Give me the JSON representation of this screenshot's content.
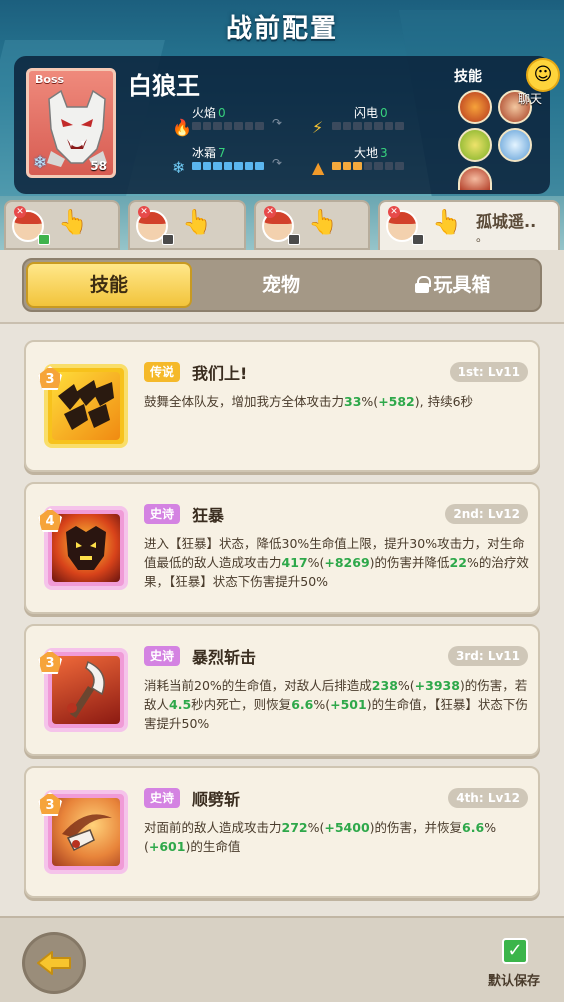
{
  "header": {
    "title": "战前配置"
  },
  "boss": {
    "badge": "Boss",
    "name": "白狼王",
    "level": "58",
    "element_icon": "snowflake-icon",
    "stats": [
      {
        "name": "火焰",
        "value": "0",
        "icon": "fire-icon",
        "filled": 0,
        "total": 7
      },
      {
        "name": "闪电",
        "value": "0",
        "icon": "lightning-icon",
        "filled": 0,
        "total": 7
      },
      {
        "name": "冰霜",
        "value": "7",
        "icon": "snowflake-icon",
        "filled": 7,
        "total": 7
      },
      {
        "name": "大地",
        "value": "3",
        "icon": "earth-icon",
        "filled": 3,
        "total": 7
      }
    ],
    "skills_label": "技能",
    "skill_icons": [
      "wolf-howl-icon",
      "slash-icon",
      "shield-icon",
      "crystal-icon",
      "claw-icon"
    ]
  },
  "chat": {
    "label": "聊天"
  },
  "heroes": [
    {
      "name": "",
      "badge": "green"
    },
    {
      "name": "",
      "badge": "gray"
    },
    {
      "name": "",
      "badge": "gray"
    },
    {
      "name": "孤城遥..",
      "name2": "。",
      "badge": "gray",
      "active": true
    }
  ],
  "tabs": {
    "skills": "技能",
    "pets": "宠物",
    "toybox": "玩具箱"
  },
  "skills": [
    {
      "stars": "3",
      "rarity": "传说",
      "rarity_class": "legend",
      "name": "我们上!",
      "level": "1st: Lv11",
      "desc": [
        [
          "t",
          "鼓舞全体队友，增加我方全体攻击力"
        ],
        [
          "g",
          "33"
        ],
        [
          "t",
          "%("
        ],
        [
          "g",
          "+582"
        ],
        [
          "t",
          "), 持续6秒"
        ]
      ]
    },
    {
      "stars": "4",
      "rarity": "史诗",
      "rarity_class": "epic",
      "name": "狂暴",
      "level": "2nd: Lv12",
      "desc": [
        [
          "t",
          "进入【狂暴】状态，降低30%生命值上限，提升30%攻击力，对生命值最低的敌人造成攻击力"
        ],
        [
          "g",
          "417"
        ],
        [
          "t",
          "%("
        ],
        [
          "g",
          "+8269"
        ],
        [
          "t",
          ")的伤害并降低"
        ],
        [
          "g",
          "22"
        ],
        [
          "t",
          "%的治疗效果，【狂暴】状态下伤害提升50%"
        ]
      ]
    },
    {
      "stars": "3",
      "rarity": "史诗",
      "rarity_class": "epic",
      "name": "暴烈斩击",
      "level": "3rd: Lv11",
      "desc": [
        [
          "t",
          "消耗当前20%的生命值，对敌人后排造成"
        ],
        [
          "g",
          "238"
        ],
        [
          "t",
          "%("
        ],
        [
          "g",
          "+3938"
        ],
        [
          "t",
          ")的伤害，若敌人"
        ],
        [
          "g",
          "4.5"
        ],
        [
          "t",
          "秒内死亡，则恢复"
        ],
        [
          "g",
          "6.6"
        ],
        [
          "t",
          "%("
        ],
        [
          "g",
          "+501"
        ],
        [
          "t",
          ")的生命值，【狂暴】状态下伤害提升50%"
        ]
      ]
    },
    {
      "stars": "3",
      "rarity": "史诗",
      "rarity_class": "epic",
      "name": "顺劈斩",
      "level": "4th: Lv12",
      "desc": [
        [
          "t",
          "对面前的敌人造成攻击力"
        ],
        [
          "g",
          "272"
        ],
        [
          "t",
          "%("
        ],
        [
          "g",
          "+5400"
        ],
        [
          "t",
          ")的伤害，并恢复"
        ],
        [
          "g",
          "6.6"
        ],
        [
          "t",
          "%("
        ],
        [
          "g",
          "+601"
        ],
        [
          "t",
          ")的生命值"
        ]
      ]
    }
  ],
  "footer": {
    "save_label": "默认保存"
  }
}
